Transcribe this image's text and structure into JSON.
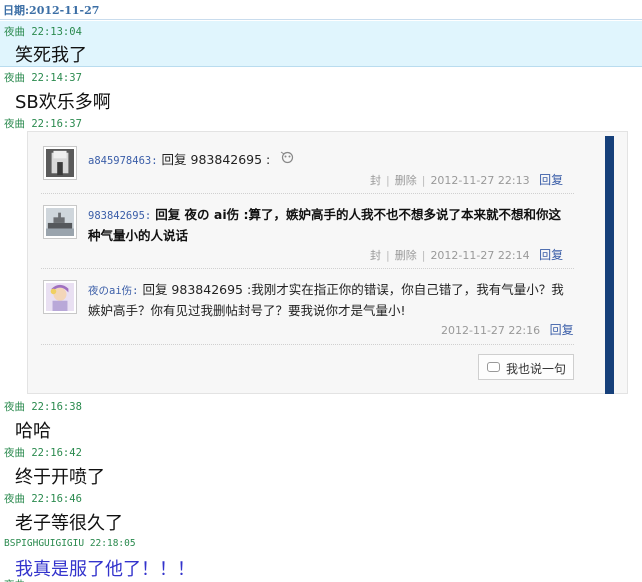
{
  "date_header": "日期:2012-11-27",
  "messages": [
    {
      "author": "夜曲",
      "time": "22:13:04",
      "text": "笑死我了"
    },
    {
      "author": "夜曲",
      "time": "22:14:37",
      "text": "SB欢乐多啊"
    },
    {
      "author": "夜曲",
      "time": "22:16:37",
      "text": ""
    },
    {
      "author": "夜曲",
      "time": "22:16:38",
      "text": "哈哈"
    },
    {
      "author": "夜曲",
      "time": "22:16:42",
      "text": "终于开喷了"
    },
    {
      "author": "夜曲",
      "time": "22:16:46",
      "text": "老子等很久了"
    },
    {
      "author": "BSPIGHGUIGIGIU",
      "time": "22:18:05",
      "text": "我真是服了他了！！！"
    }
  ],
  "replies": [
    {
      "name": "a845978463:",
      "prefix": "回复 983842695 :",
      "body": "",
      "ban": "封",
      "delete": "删除",
      "time": "2012-11-27 22:13",
      "reply": "回复"
    },
    {
      "name": "983842695:",
      "prefix": "回复 夜の ai伤 :",
      "body": "算了，嫉妒高手的人我不也不想多说了本来就不想和你这种气量小的人说话",
      "ban": "封",
      "delete": "删除",
      "time": "2012-11-27 22:14",
      "reply": "回复"
    },
    {
      "name": "夜のai伤:",
      "prefix": "回复 983842695 :",
      "body": "我刚才实在指正你的错误，你自己错了，我有气量小？我嫉妒高手？你有见过我删帖封号了？要我说你才是气量小!",
      "time": "2012-11-27 22:16",
      "reply": "回复"
    }
  ],
  "say_button": "我也说一句",
  "partial_bottom_author": "夜曲",
  "colors": {
    "accent": "#16407a",
    "highlight": "#e0f5fd",
    "meta_green": "#2a8a4e",
    "link_blue": "#3b5ea8"
  }
}
